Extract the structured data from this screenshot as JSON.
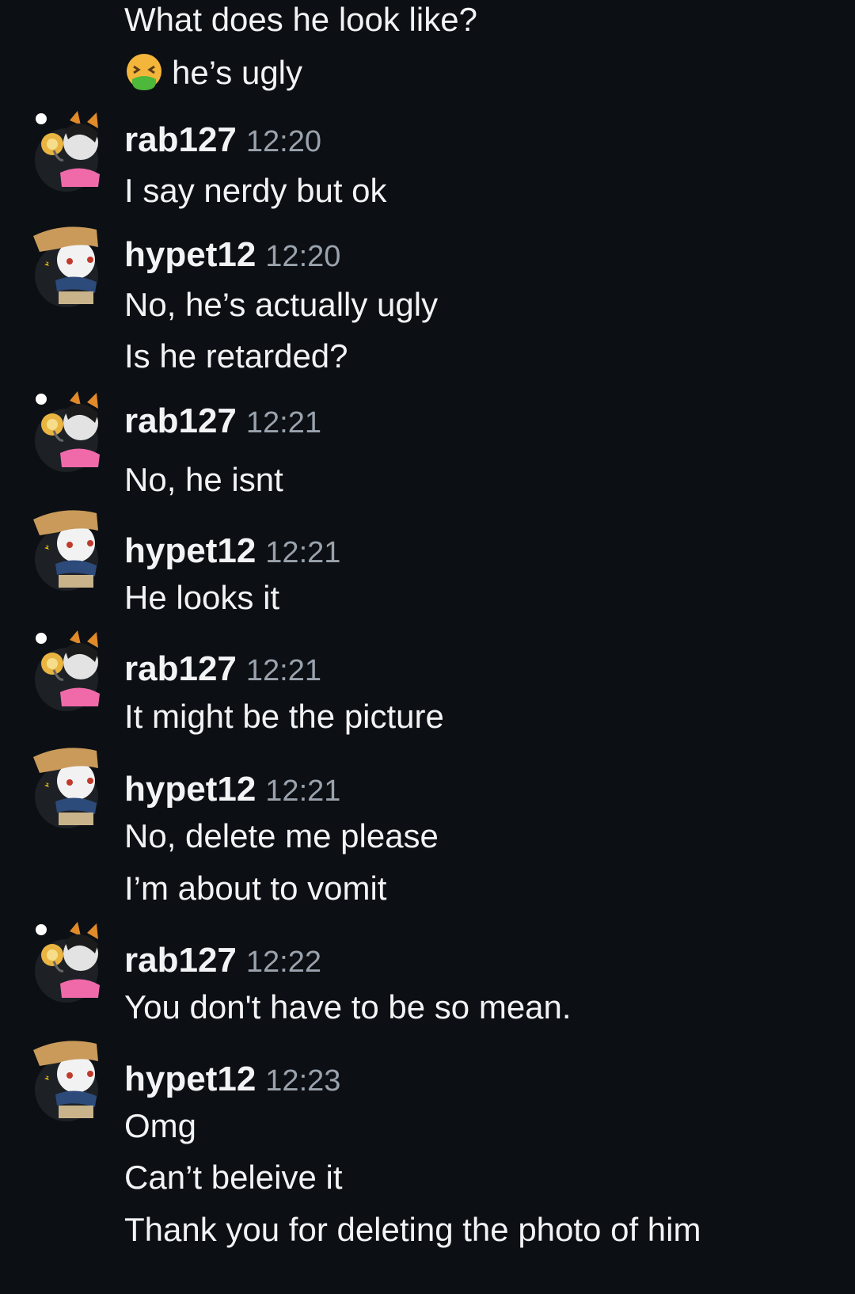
{
  "messages": [
    {
      "lines": [
        "What does he look like?"
      ]
    },
    {
      "lines": [
        "he’s ugly"
      ],
      "emoji": "nauseated-face-icon"
    },
    {
      "author": "rab127",
      "time": "12:20",
      "lines": [
        "I say nerdy but ok"
      ]
    },
    {
      "author": "hypet12",
      "time": "12:20",
      "lines": [
        "No, he’s actually ugly",
        "Is he retarded?"
      ]
    },
    {
      "author": "rab127",
      "time": "12:21",
      "lines": [
        "No, he isnt"
      ]
    },
    {
      "author": "hypet12",
      "time": "12:21",
      "lines": [
        "He looks it"
      ]
    },
    {
      "author": "rab127",
      "time": "12:21",
      "lines": [
        "It might be the picture"
      ]
    },
    {
      "author": "hypet12",
      "time": "12:21",
      "lines": [
        "No, delete me please",
        "I’m about to vomit"
      ]
    },
    {
      "author": "rab127",
      "time": "12:22",
      "lines": [
        "You don't have to be so mean."
      ]
    },
    {
      "author": "hypet12",
      "time": "12:23",
      "lines": [
        "Omg",
        "Can’t beleive it",
        "Thank you for deleting the photo of him"
      ]
    }
  ],
  "avatars": {
    "rab127": "cat-ear-headset-avatar-icon",
    "hypet12": "brown-hair-scarf-avatar-icon"
  },
  "colors": {
    "background": "#0c0f13",
    "text": "#f2f3f5",
    "timestamp": "#9aa3ad"
  }
}
